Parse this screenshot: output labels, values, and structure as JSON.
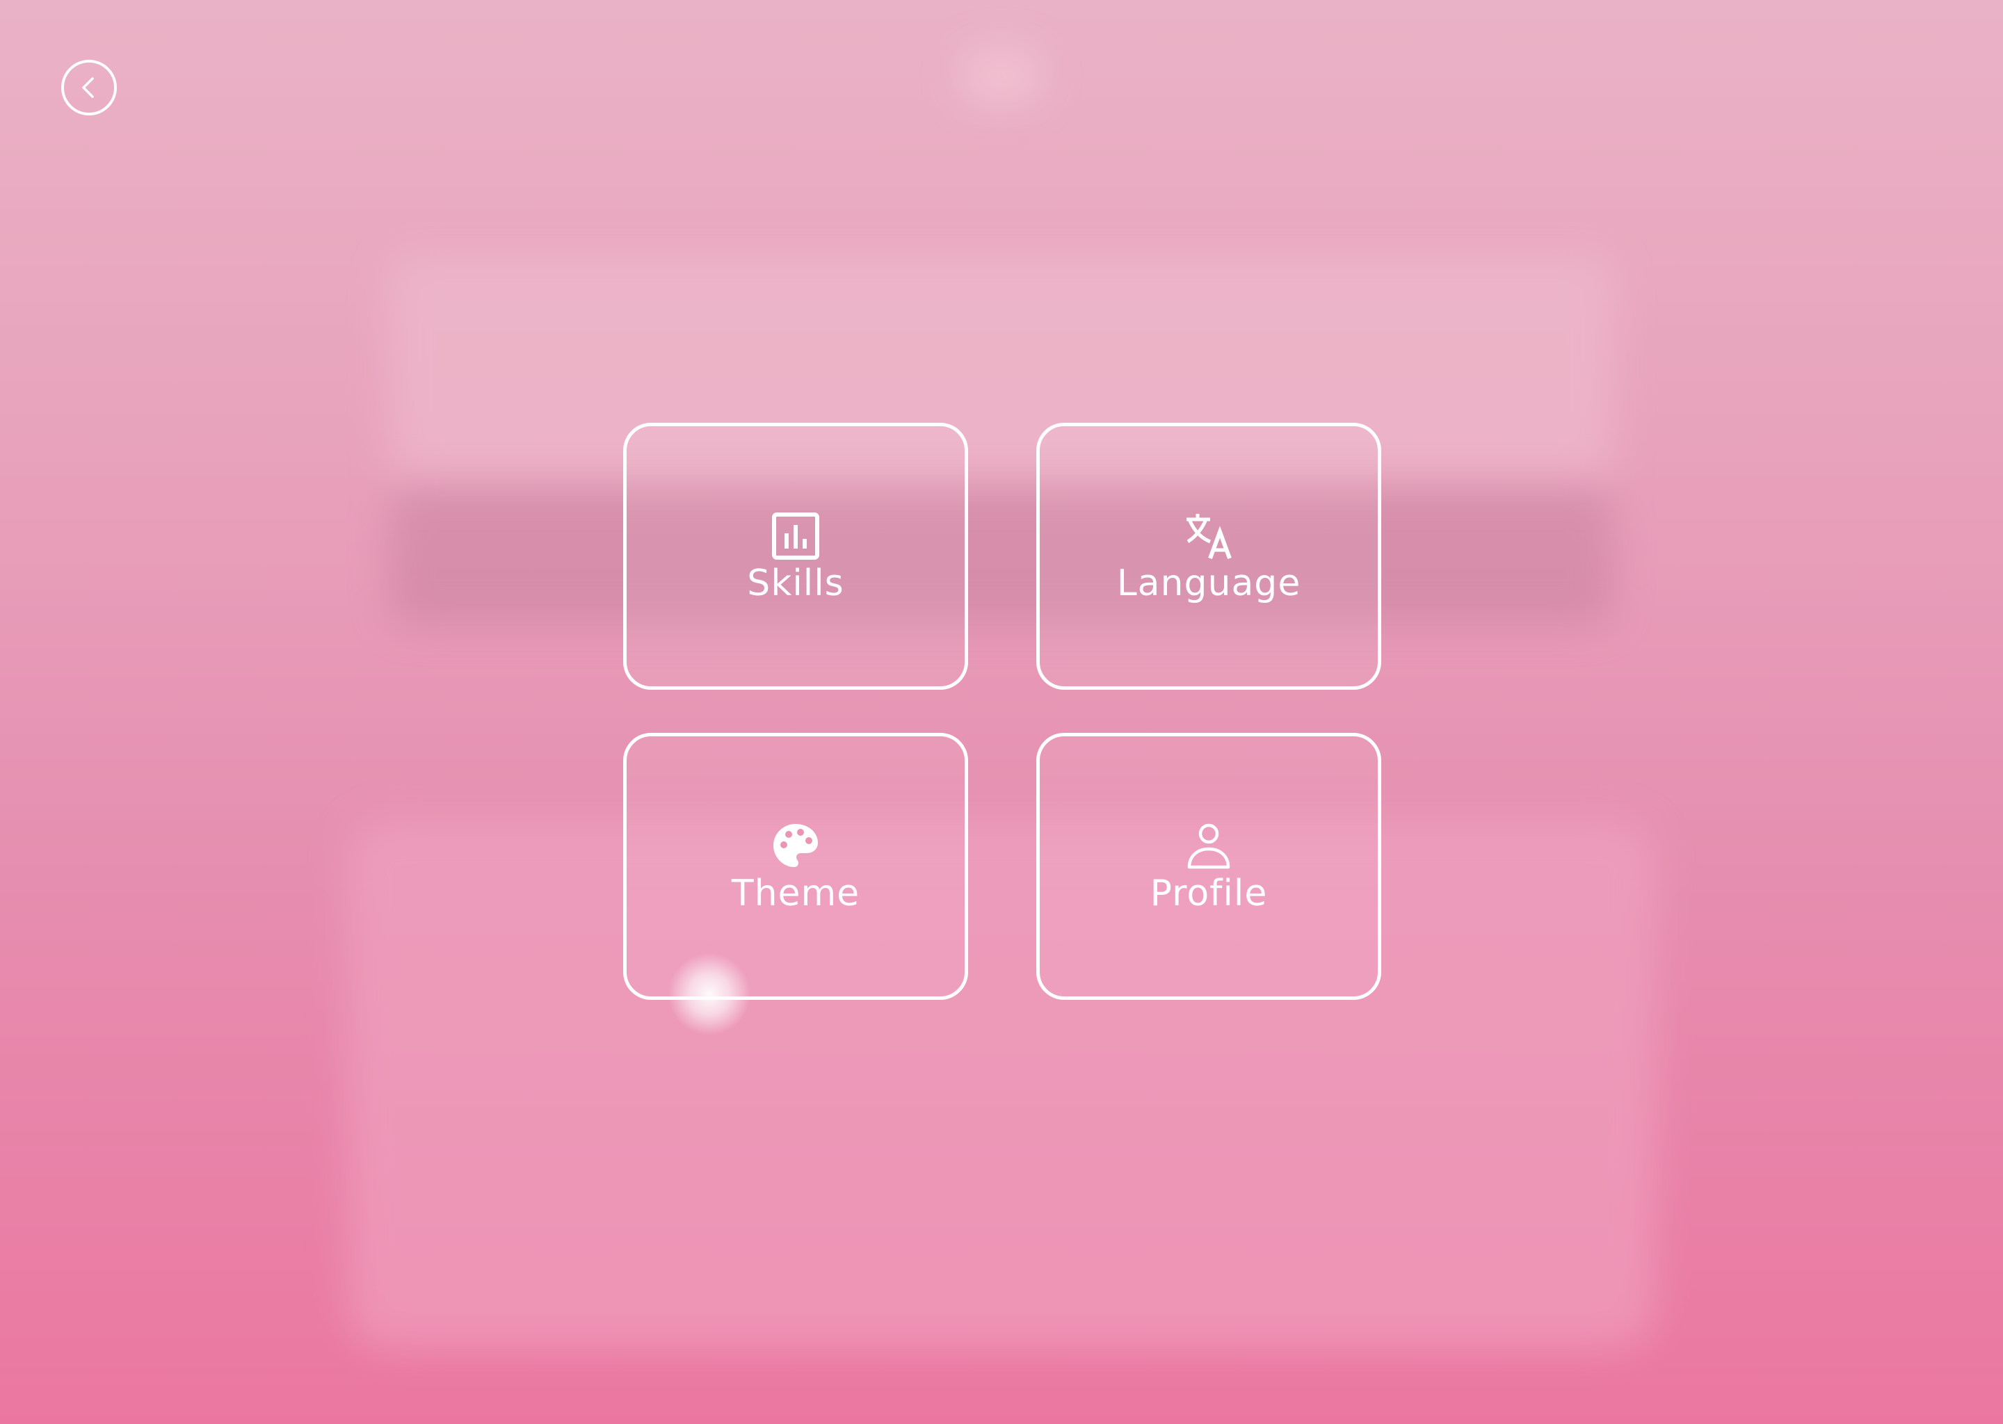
{
  "navigation": {
    "back_icon": "chevron-left-icon"
  },
  "menu": {
    "tiles": [
      {
        "label": "Skills",
        "icon": "bar-chart-icon"
      },
      {
        "label": "Language",
        "icon": "translate-icon"
      },
      {
        "label": "Theme",
        "icon": "palette-icon"
      },
      {
        "label": "Profile",
        "icon": "person-icon"
      }
    ]
  },
  "colors": {
    "background_top": "#eab2c6",
    "background_bottom": "#eb77a0",
    "foreground": "#ffffff"
  }
}
